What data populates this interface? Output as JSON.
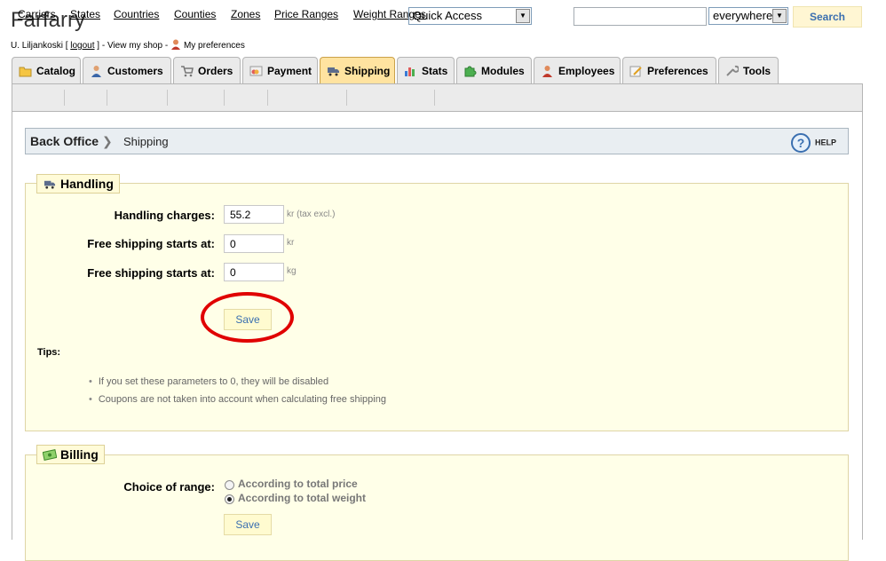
{
  "header": {
    "shop_name": "Farfarry",
    "user_name": "U. Liljankoski",
    "logout_label": "logout",
    "view_shop_label": "View my shop",
    "my_preferences_label": "My preferences",
    "quick_access": "Quick Access",
    "search_value": "",
    "search_scope": "everywhere",
    "search_button": "Search"
  },
  "tabs": [
    {
      "label": "Catalog",
      "icon": "folder-icon"
    },
    {
      "label": "Customers",
      "icon": "customer-icon"
    },
    {
      "label": "Orders",
      "icon": "cart-icon"
    },
    {
      "label": "Payment",
      "icon": "payment-icon"
    },
    {
      "label": "Shipping",
      "icon": "truck-icon",
      "active": true
    },
    {
      "label": "Stats",
      "icon": "stats-icon"
    },
    {
      "label": "Modules",
      "icon": "puzzle-icon"
    },
    {
      "label": "Employees",
      "icon": "employee-icon"
    },
    {
      "label": "Preferences",
      "icon": "preferences-icon"
    },
    {
      "label": "Tools",
      "icon": "wrench-icon"
    }
  ],
  "subnav": [
    "Carriers",
    "States",
    "Countries",
    "Counties",
    "Zones",
    "Price Ranges",
    "Weight Ranges"
  ],
  "breadcrumb": {
    "root": "Back Office",
    "page": "Shipping",
    "help_label": "HELP"
  },
  "handling": {
    "legend": "Handling",
    "fields": [
      {
        "label": "Handling charges:",
        "value": "55.2",
        "unit": "kr (tax excl.)"
      },
      {
        "label": "Free shipping starts at:",
        "value": "0",
        "unit": "kr"
      },
      {
        "label": "Free shipping starts at:",
        "value": "0",
        "unit": "kg"
      }
    ],
    "save_label": "Save",
    "tips_label": "Tips:",
    "tips": [
      "If you set these parameters to 0, they will be disabled",
      "Coupons are not taken into account when calculating free shipping"
    ]
  },
  "billing": {
    "legend": "Billing",
    "choice_label": "Choice of range:",
    "options": [
      "According to total price",
      "According to total weight"
    ],
    "selected_option": "According to total weight",
    "save_label": "Save"
  },
  "colors": {
    "active_tab": "#ffe3a0",
    "fieldset_bg": "#ffffe8",
    "button_text": "#3a6fb0",
    "highlight": "#e00000"
  }
}
